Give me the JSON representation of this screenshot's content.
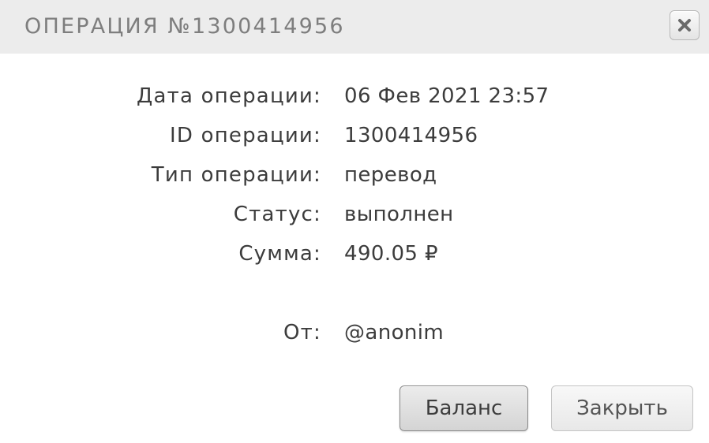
{
  "header": {
    "title": "ОПЕРАЦИЯ №1300414956",
    "close_icon": "close-icon"
  },
  "details": [
    {
      "label": "Дата операции:",
      "value": "06 Фев 2021 23:57"
    },
    {
      "label": "ID операции:",
      "value": "1300414956"
    },
    {
      "label": "Тип операции:",
      "value": "перевод"
    },
    {
      "label": "Статус:",
      "value": "выполнен"
    },
    {
      "label": "Сумма:",
      "value": "490.05 ₽"
    }
  ],
  "sender": {
    "label": "От:",
    "value": "@anonim"
  },
  "buttons": {
    "balance_label": "Баланс",
    "close_label": "Закрыть"
  }
}
